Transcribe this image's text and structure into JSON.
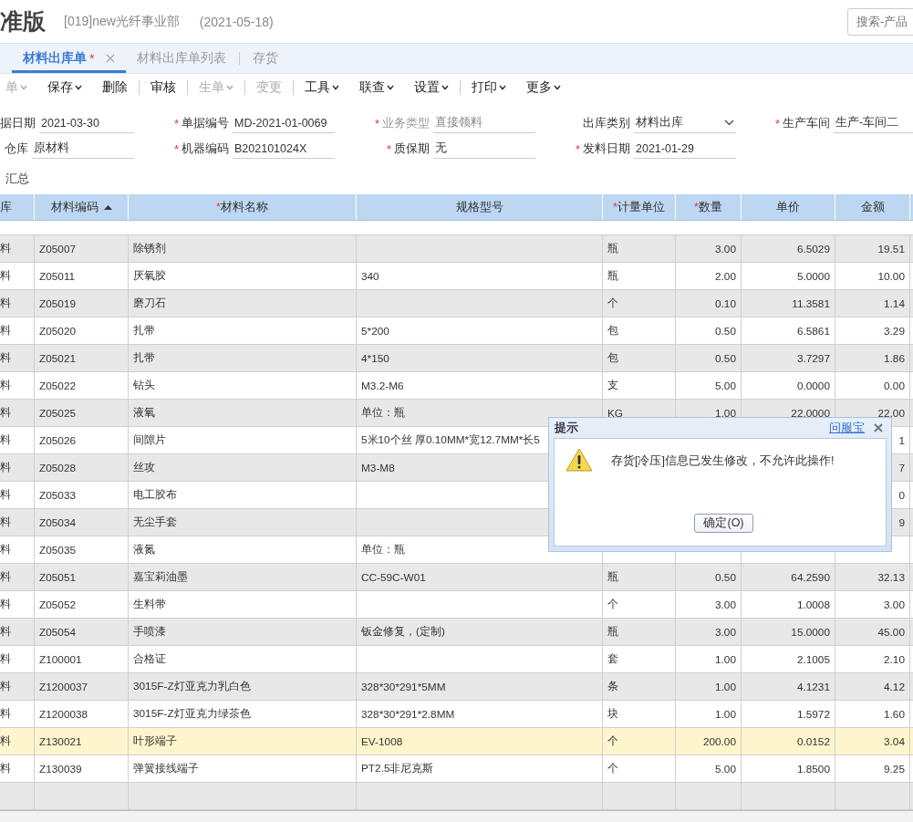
{
  "header": {
    "title": "准版",
    "org": "[019]new光纤事业部",
    "date": "(2021-05-18)",
    "search": {
      "placeholder": "搜索-产品"
    }
  },
  "tabs": [
    {
      "label": "材料出库单",
      "mark": "*",
      "closable": true,
      "selected": true
    },
    {
      "label": "材料出库单列表",
      "closable": false,
      "selected": false
    },
    {
      "label": "存货",
      "closable": false,
      "selected": false
    }
  ],
  "toolbar": [
    {
      "label": "单",
      "dropdown": true,
      "disabled": true,
      "separator_after": false
    },
    {
      "label": "保存",
      "dropdown": true,
      "disabled": false,
      "separator_after": false
    },
    {
      "label": "删除",
      "dropdown": false,
      "disabled": false,
      "separator_after": true
    },
    {
      "label": "审核",
      "dropdown": false,
      "disabled": false,
      "separator_after": true
    },
    {
      "label": "生单",
      "dropdown": true,
      "disabled": true,
      "separator_after": true
    },
    {
      "label": "变更",
      "dropdown": false,
      "disabled": true,
      "separator_after": true
    },
    {
      "label": "工具",
      "dropdown": true,
      "disabled": false,
      "separator_after": false
    },
    {
      "label": "联查",
      "dropdown": true,
      "disabled": false,
      "separator_after": false
    },
    {
      "label": "设置",
      "dropdown": true,
      "disabled": false,
      "separator_after": true
    },
    {
      "label": "打印",
      "dropdown": true,
      "disabled": false,
      "separator_after": false
    },
    {
      "label": "更多",
      "dropdown": true,
      "disabled": false,
      "separator_after": false
    }
  ],
  "form": [
    [
      {
        "label": "据日期",
        "value": "2021-03-30",
        "kind": "text",
        "disabled": false
      },
      {
        "mark": "*",
        "label": "单据编号",
        "value": "MD-2021-01-0069",
        "kind": "text",
        "disabled": false
      },
      {
        "mark": "*",
        "label": "业务类型",
        "value": "直接领料",
        "kind": "text",
        "disabled": true
      },
      {
        "label": "出库类别",
        "value": "材料出库",
        "kind": "select",
        "disabled": false
      },
      {
        "mark": "*",
        "label": "生产车间",
        "value": "生产-车间二",
        "kind": "text",
        "disabled": false
      }
    ],
    [
      {
        "label": "仓库",
        "value": "原材料",
        "kind": "text",
        "disabled": false
      },
      {
        "mark": "*",
        "label": "机器编码",
        "value": "B202101024X",
        "kind": "text",
        "disabled": false
      },
      {
        "mark": "*",
        "label": "质保期",
        "value": "无",
        "kind": "text",
        "disabled": false
      },
      {
        "mark": "*",
        "label": "发料日期",
        "value": "2021-01-29",
        "kind": "text",
        "disabled": false
      }
    ]
  ],
  "summary_label": "汇总",
  "table": {
    "columns": [
      {
        "label": "库",
        "sorted": false
      },
      {
        "label": "材料编码",
        "sorted": true
      },
      {
        "mark": "*",
        "label": "材料名称",
        "sorted": false
      },
      {
        "label": "规格型号",
        "sorted": false
      },
      {
        "mark": "*",
        "label": "计量单位",
        "sorted": false
      },
      {
        "mark": "*",
        "label": "数量",
        "sorted": false
      },
      {
        "label": "单价",
        "sorted": false
      },
      {
        "label": "金额",
        "sorted": false
      }
    ],
    "rows": [
      {
        "selected": false,
        "cells": [
          "料",
          "Z05007",
          "除锈剂",
          null,
          "瓶",
          "3.00",
          "6.5029",
          "19.51"
        ]
      },
      {
        "selected": false,
        "cells": [
          "料",
          "Z05011",
          "厌氧胶",
          "340",
          "瓶",
          "2.00",
          "5.0000",
          "10.00"
        ]
      },
      {
        "selected": false,
        "cells": [
          "料",
          "Z05019",
          "磨刀石",
          null,
          "个",
          "0.10",
          "11.3581",
          "1.14"
        ]
      },
      {
        "selected": false,
        "cells": [
          "料",
          "Z05020",
          "扎带",
          "5*200",
          "包",
          "0.50",
          "6.5861",
          "3.29"
        ]
      },
      {
        "selected": false,
        "cells": [
          "料",
          "Z05021",
          "扎带",
          "4*150",
          "包",
          "0.50",
          "3.7297",
          "1.86"
        ]
      },
      {
        "selected": false,
        "cells": [
          "料",
          "Z05022",
          "钻头",
          "M3.2-M6",
          "支",
          "5.00",
          "0.0000",
          "0.00"
        ]
      },
      {
        "selected": false,
        "cells": [
          "料",
          "Z05025",
          "液氧",
          "单位：瓶",
          "KG",
          "1.00",
          "22.0000",
          "22.00"
        ]
      },
      {
        "selected": false,
        "cells": [
          "料",
          "Z05026",
          "间隙片",
          "5米10个丝  厚0.10MM*宽12.7MM*长5",
          null,
          null,
          null,
          "1"
        ]
      },
      {
        "selected": false,
        "cells": [
          "料",
          "Z05028",
          "丝攻",
          "M3-M8",
          null,
          null,
          null,
          "7"
        ]
      },
      {
        "selected": false,
        "cells": [
          "料",
          "Z05033",
          "电工胶布",
          null,
          null,
          null,
          null,
          "0"
        ]
      },
      {
        "selected": false,
        "cells": [
          "料",
          "Z05034",
          "无尘手套",
          null,
          null,
          null,
          null,
          "9"
        ]
      },
      {
        "selected": false,
        "cells": [
          "料",
          "Z05035",
          "液氮",
          "单位：瓶",
          null,
          null,
          null,
          null
        ]
      },
      {
        "selected": false,
        "cells": [
          "料",
          "Z05051",
          "嘉宝莉油墨",
          "CC-59C-W01",
          "瓶",
          "0.50",
          "64.2590",
          "32.13"
        ]
      },
      {
        "selected": false,
        "cells": [
          "料",
          "Z05052",
          "生料带",
          null,
          "个",
          "3.00",
          "1.0008",
          "3.00"
        ]
      },
      {
        "selected": false,
        "cells": [
          "料",
          "Z05054",
          "手喷漆",
          "钣金修复，(定制)",
          "瓶",
          "3.00",
          "15.0000",
          "45.00"
        ]
      },
      {
        "selected": false,
        "cells": [
          "料",
          "Z100001",
          "合格证",
          null,
          "套",
          "1.00",
          "2.1005",
          "2.10"
        ]
      },
      {
        "selected": false,
        "cells": [
          "料",
          "Z1200037",
          "3015F-Z灯亚克力乳白色",
          "328*30*291*5MM",
          "条",
          "1.00",
          "4.1231",
          "4.12"
        ]
      },
      {
        "selected": false,
        "cells": [
          "料",
          "Z1200038",
          "3015F-Z灯亚克力绿茶色",
          "328*30*291*2.8MM",
          "块",
          "1.00",
          "1.5972",
          "1.60"
        ]
      },
      {
        "selected": true,
        "cells": [
          "料",
          "Z130021",
          "叶形端子",
          "EV-1008",
          "个",
          "200.00",
          "0.0152",
          "3.04"
        ]
      },
      {
        "selected": false,
        "cells": [
          "料",
          "Z130039",
          "弹簧接线端子",
          "PT2.5非尼克斯",
          "个",
          "5.00",
          "1.8500",
          "9.25"
        ]
      },
      {
        "selected": false,
        "cells": [
          null,
          null,
          null,
          null,
          null,
          null,
          null,
          null
        ]
      }
    ]
  },
  "dialog": {
    "title": "提示",
    "help_link": "问服宝",
    "message": "存货[冷压]信息已发生修改，不允许此操作!",
    "button": "确定(O)"
  }
}
